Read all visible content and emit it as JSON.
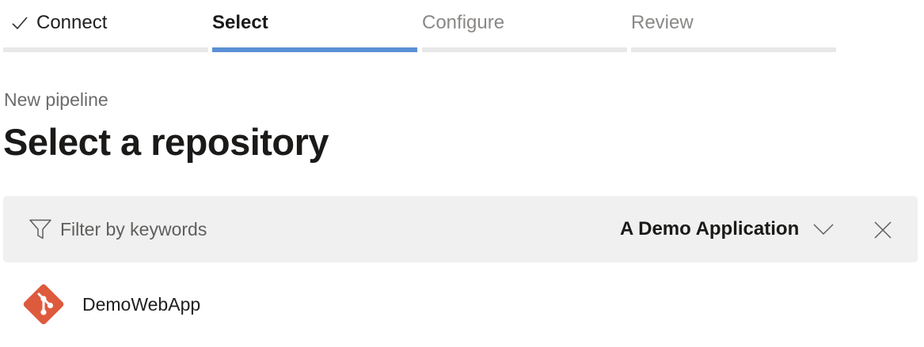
{
  "stepper": {
    "steps": [
      {
        "label": "Connect",
        "state": "completed"
      },
      {
        "label": "Select",
        "state": "active"
      },
      {
        "label": "Configure",
        "state": "upcoming"
      },
      {
        "label": "Review",
        "state": "upcoming"
      }
    ]
  },
  "header": {
    "breadcrumb": "New pipeline",
    "title": "Select a repository"
  },
  "filter": {
    "placeholder": "Filter by keywords",
    "value": "",
    "project_label": "A Demo Application",
    "icons": {
      "filter": "filter-funnel-icon",
      "dropdown": "chevron-down-icon",
      "clear": "close-icon"
    }
  },
  "repositories": [
    {
      "name": "DemoWebApp",
      "icon": "git-repo-icon"
    }
  ],
  "colors": {
    "accent": "#5a8fd4",
    "step_track": "#e8e8e8",
    "filter_background": "#f0f0f0",
    "git_brand": "#de5a3c",
    "muted_text": "#8a8886"
  }
}
